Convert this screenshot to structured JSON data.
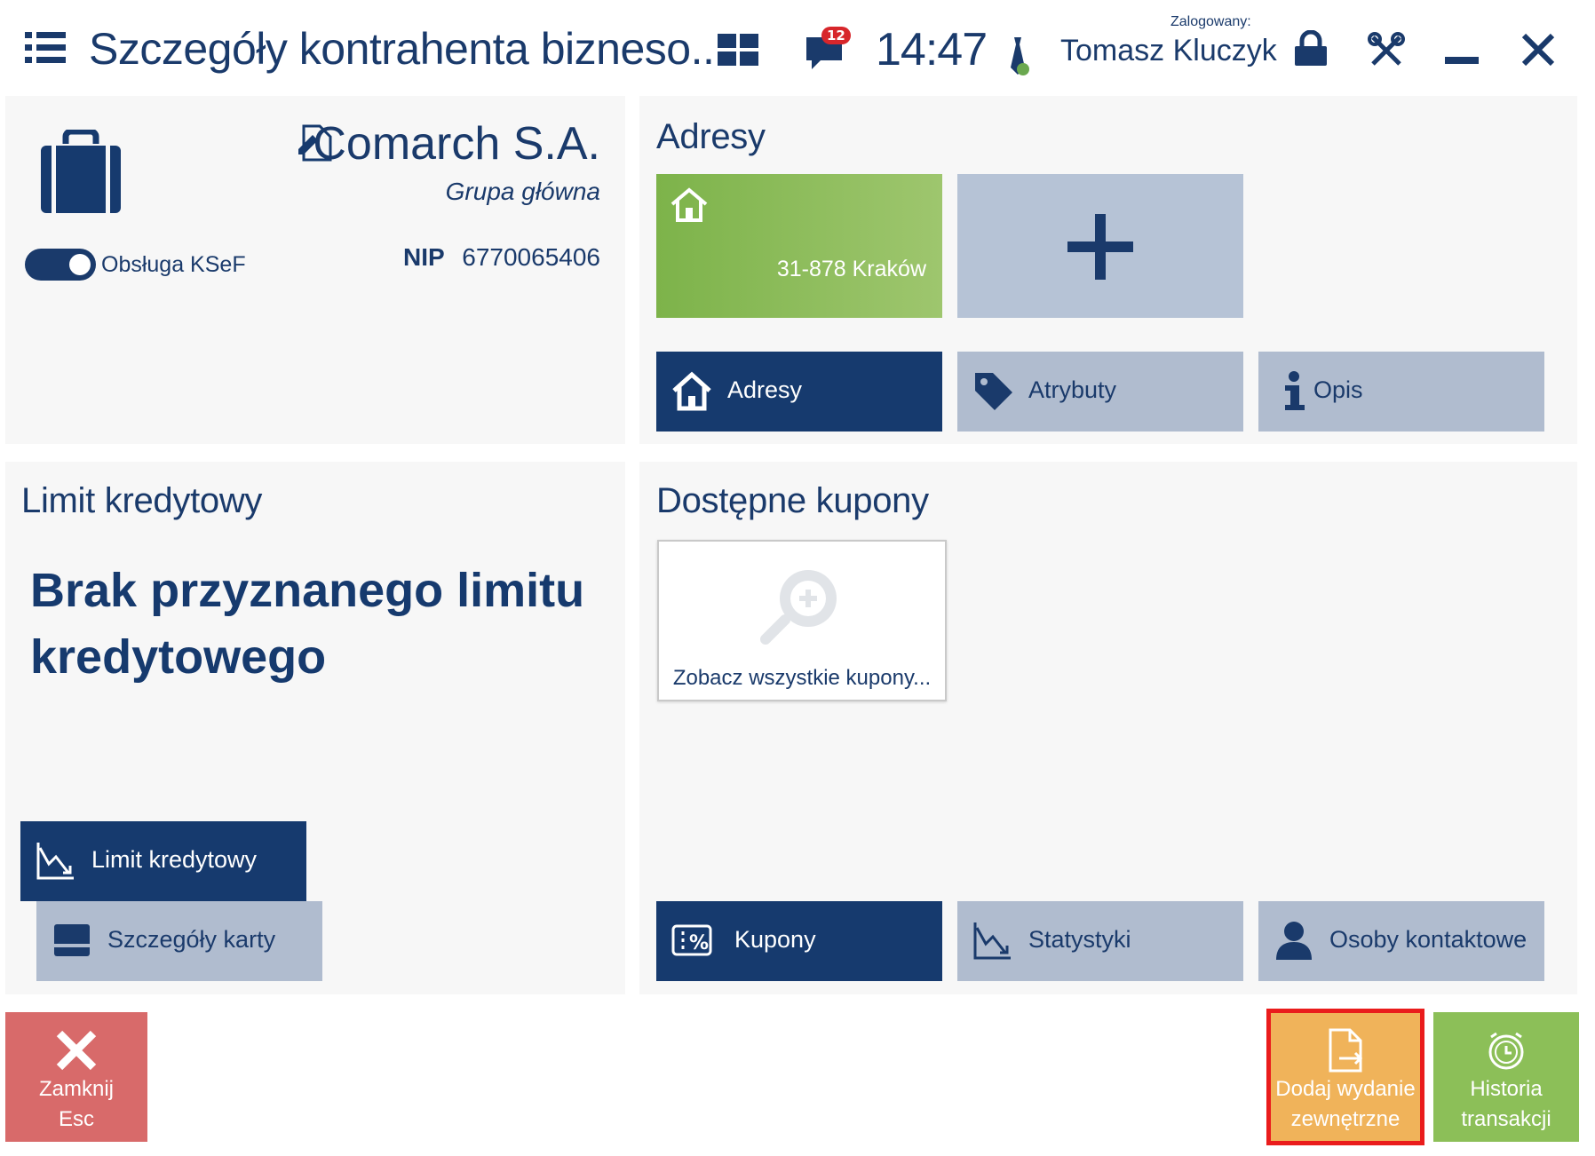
{
  "header": {
    "title": "Szczegóły kontrahenta bizneso...",
    "notification_count": "12",
    "time": "14:47",
    "logged_label": "Zalogowany:",
    "user_name": "Tomasz Kluczyk"
  },
  "company": {
    "name": "Comarch S.A.",
    "group": "Grupa główna",
    "ksef_toggle_label": "Obsługa KSeF",
    "ksef_enabled": true,
    "nip_label": "NIP",
    "nip_value": "6770065406"
  },
  "addresses": {
    "title": "Adresy",
    "items": [
      {
        "city": "31-878 Kraków"
      }
    ],
    "tabs": [
      {
        "label": "Adresy",
        "icon": "house-icon",
        "active": true
      },
      {
        "label": "Atrybuty",
        "icon": "tag-icon",
        "active": false
      },
      {
        "label": "Opis",
        "icon": "info-icon",
        "active": false
      }
    ]
  },
  "credit": {
    "title": "Limit kredytowy",
    "message": "Brak przyznanego limitu kredytowego",
    "tabs": [
      {
        "label": "Limit kredytowy",
        "icon": "chart-icon",
        "active": true
      },
      {
        "label": "Szczegóły karty",
        "icon": "card-icon",
        "active": false
      }
    ]
  },
  "coupons": {
    "title": "Dostępne kupony",
    "see_all": "Zobacz wszystkie kupony...",
    "tabs": [
      {
        "label": "Kupony",
        "icon": "percent-icon",
        "active": true
      },
      {
        "label": "Statystyki",
        "icon": "chart-icon",
        "active": false
      },
      {
        "label": "Osoby kontaktowe",
        "icon": "person-icon",
        "active": false
      }
    ]
  },
  "actions": {
    "close": {
      "line1": "Zamknij",
      "line2": "Esc"
    },
    "external": {
      "line1": "Dodaj wydanie",
      "line2": "zewnętrzne"
    },
    "history": {
      "line1": "Historia",
      "line2": "transakcji"
    }
  },
  "colors": {
    "primary": "#163a6e",
    "tab_inactive": "#b0bccf",
    "address_tile": "#7db34a",
    "close_button": "#d86a6a",
    "external_button": "#f0b35a",
    "history_button": "#8cbf58",
    "highlight_outline": "#ea1c1c"
  }
}
